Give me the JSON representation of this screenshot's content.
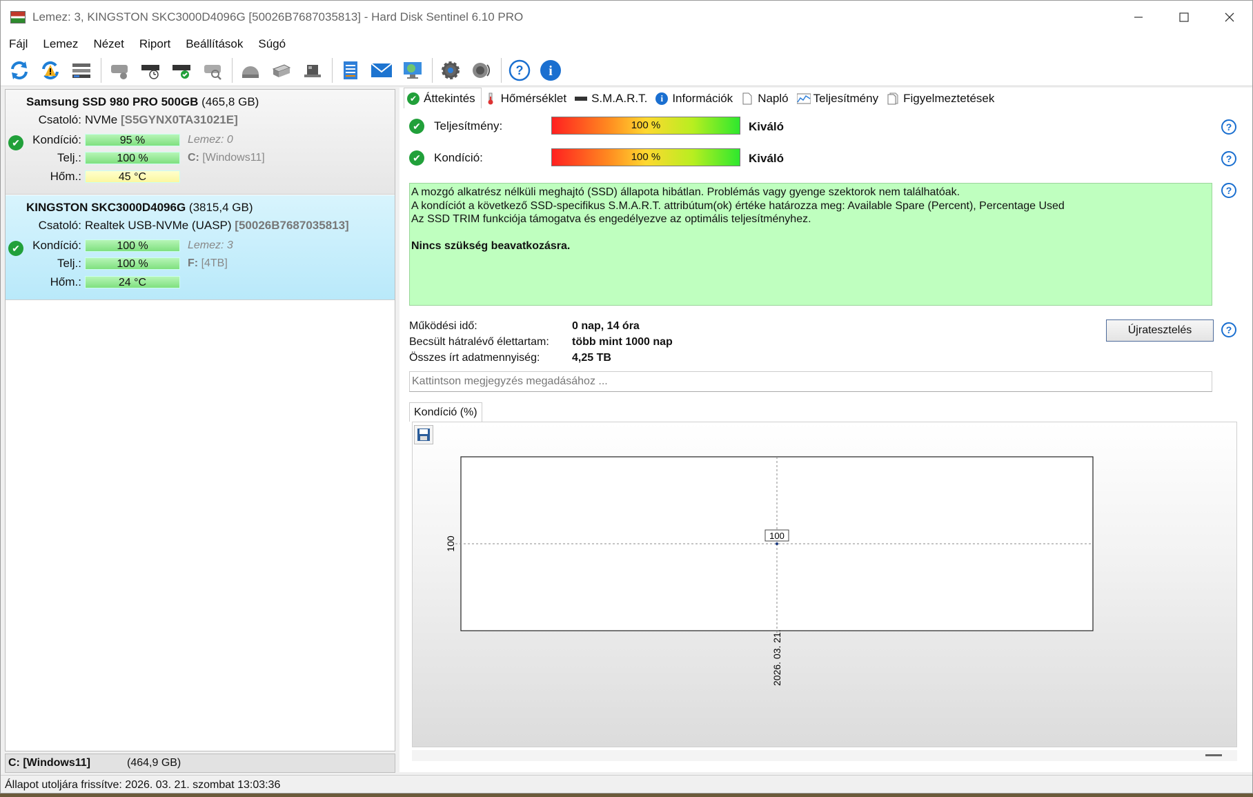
{
  "window": {
    "title": "Lemez: 3, KINGSTON SKC3000D4096G [50026B7687035813]  -  Hard Disk Sentinel 6.10 PRO",
    "minimize_icon": "minimize-icon",
    "maximize_icon": "maximize-icon",
    "close_icon": "close-icon"
  },
  "menu": [
    "Fájl",
    "Lemez",
    "Nézet",
    "Riport",
    "Beállítások",
    "Súgó"
  ],
  "toolbar_icons": [
    "refresh-icon",
    "refresh-warning-icon",
    "disk-list-icon",
    "disk-gray-icon",
    "disk-clock-icon",
    "disk-check-icon",
    "disk-search-icon",
    "dome-disk-icon",
    "usb-drive-icon",
    "network-drive-icon",
    "report-icon",
    "email-icon",
    "web-icon",
    "settings-gear-icon",
    "sound-icon",
    "help-icon",
    "info-icon"
  ],
  "disks": [
    {
      "name": "Samsung SSD 980 PRO 500GB",
      "size": "(465,8 GB)",
      "iface_label": "Csatoló:",
      "iface": "NVMe",
      "serial": "[S5GYNX0TA31021E]",
      "cond_label": "Kondíció:",
      "cond": "95 %",
      "disk_no": "Lemez: 0",
      "perf_label": "Telj.:",
      "perf": "100 %",
      "drive": "C:",
      "volume": "[Windows11]",
      "temp_label": "Hőm.:",
      "temp": "45 °C"
    },
    {
      "name": "KINGSTON SKC3000D4096G",
      "size": "(3815,4 GB)",
      "iface_label": "Csatoló:",
      "iface": "Realtek USB-NVMe (UASP)",
      "serial": "[50026B7687035813]",
      "cond_label": "Kondíció:",
      "cond": "100 %",
      "disk_no": "Lemez: 3",
      "perf_label": "Telj.:",
      "perf": "100 %",
      "drive": "F:",
      "volume": "[4TB]",
      "temp_label": "Hőm.:",
      "temp": "24 °C"
    }
  ],
  "volume_bar": {
    "drive": "C: [Windows11]",
    "size": "(464,9 GB)"
  },
  "status_bar": "Állapot utoljára frissítve: 2026. 03. 21. szombat 13:03:36",
  "tabs": [
    "Áttekintés",
    "Hőmérséklet",
    "S.M.A.R.T.",
    "Információk",
    "Napló",
    "Teljesítmény",
    "Figyelmeztetések"
  ],
  "overview": {
    "perf_label": "Teljesítmény:",
    "perf_value": "100 %",
    "perf_rating": "Kiváló",
    "cond_label": "Kondíció:",
    "cond_value": "100 %",
    "cond_rating": "Kiváló",
    "message_lines": [
      "A mozgó alkatrész nélküli meghajtó (SSD) állapota hibátlan. Problémás vagy gyenge szektorok nem találhatóak.",
      "A kondíciót a következő SSD-specifikus S.M.A.R.T. attribútum(ok) értéke határozza meg:  Available Spare (Percent), Percentage Used",
      "Az SSD TRIM funkciója támogatva és engedélyezve az optimális teljesítményhez."
    ],
    "message_action": "Nincs szükség beavatkozásra.",
    "uptime_label": "Működési idő:",
    "uptime_value": "0 nap, 14 óra",
    "life_label": "Becsült hátralévő élettartam:",
    "life_value": "több mint 1000 nap",
    "written_label": "Összes írt adatmennyiség:",
    "written_value": "4,25 TB",
    "retest_button": "Újratesztelés",
    "comment_placeholder": "Kattintson megjegyzés megadásához ...",
    "chart_tab": "Kondíció  (%)"
  },
  "chart_data": {
    "type": "line",
    "x": [
      "2026. 03. 21."
    ],
    "series": [
      {
        "values": [
          100
        ]
      }
    ],
    "yticks": [
      "100"
    ],
    "point_labels": [
      "100"
    ],
    "grid": true
  }
}
